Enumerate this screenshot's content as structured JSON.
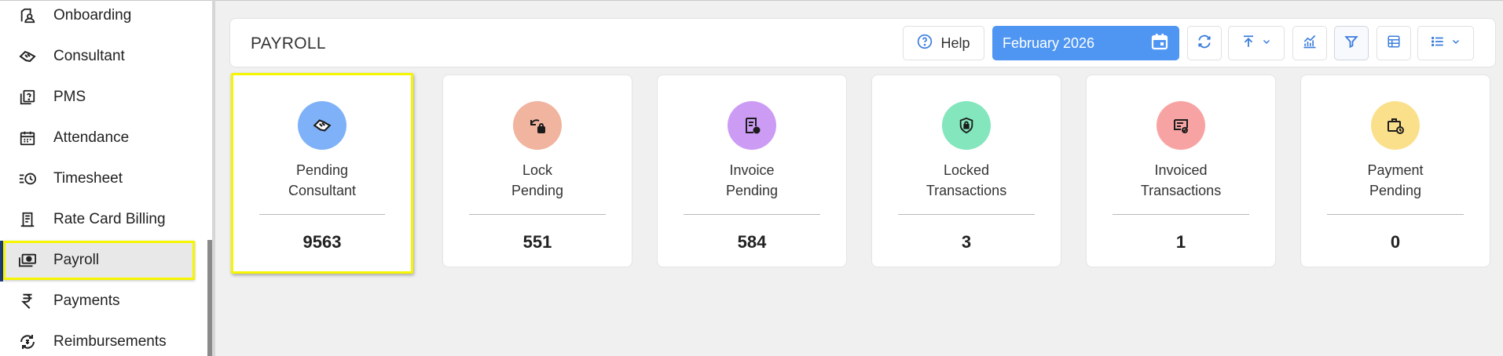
{
  "sidebar": {
    "items": [
      {
        "label": "Onboarding",
        "icon": "user-folder-icon"
      },
      {
        "label": "Consultant",
        "icon": "handshake-icon"
      },
      {
        "label": "PMS",
        "icon": "question-doc-icon"
      },
      {
        "label": "Attendance",
        "icon": "calendar-icon"
      },
      {
        "label": "Timesheet",
        "icon": "list-clock-icon"
      },
      {
        "label": "Rate Card Billing",
        "icon": "receipt-icon"
      },
      {
        "label": "Payroll",
        "icon": "money-icon",
        "active": true
      },
      {
        "label": "Payments",
        "icon": "rupee-icon"
      },
      {
        "label": "Reimbursements",
        "icon": "refund-icon"
      }
    ]
  },
  "header": {
    "title": "PAYROLL",
    "help_label": "Help",
    "date_label": "February 2026"
  },
  "cards": [
    {
      "line1": "Pending",
      "line2": "Consultant",
      "value": "9563",
      "color": "#7eb1f7",
      "icon": "handshake-icon"
    },
    {
      "line1": "Lock",
      "line2": "Pending",
      "value": "551",
      "color": "#f0b49f",
      "icon": "lock-refresh-icon"
    },
    {
      "line1": "Invoice",
      "line2": "Pending",
      "value": "584",
      "color": "#cc9cf5",
      "icon": "invoice-icon"
    },
    {
      "line1": "Locked",
      "line2": "Transactions",
      "value": "3",
      "color": "#83e6bd",
      "icon": "shield-lock-icon"
    },
    {
      "line1": "Invoiced",
      "line2": "Transactions",
      "value": "1",
      "color": "#f8a3a3",
      "icon": "invoice-check-icon"
    },
    {
      "line1": "Payment",
      "line2": "Pending",
      "value": "0",
      "color": "#fbe08c",
      "icon": "briefcase-clock-icon"
    }
  ],
  "colors": {
    "accent": "#4f96f2",
    "highlight": "#f5f500",
    "icon_blue": "#3b7ddd"
  }
}
